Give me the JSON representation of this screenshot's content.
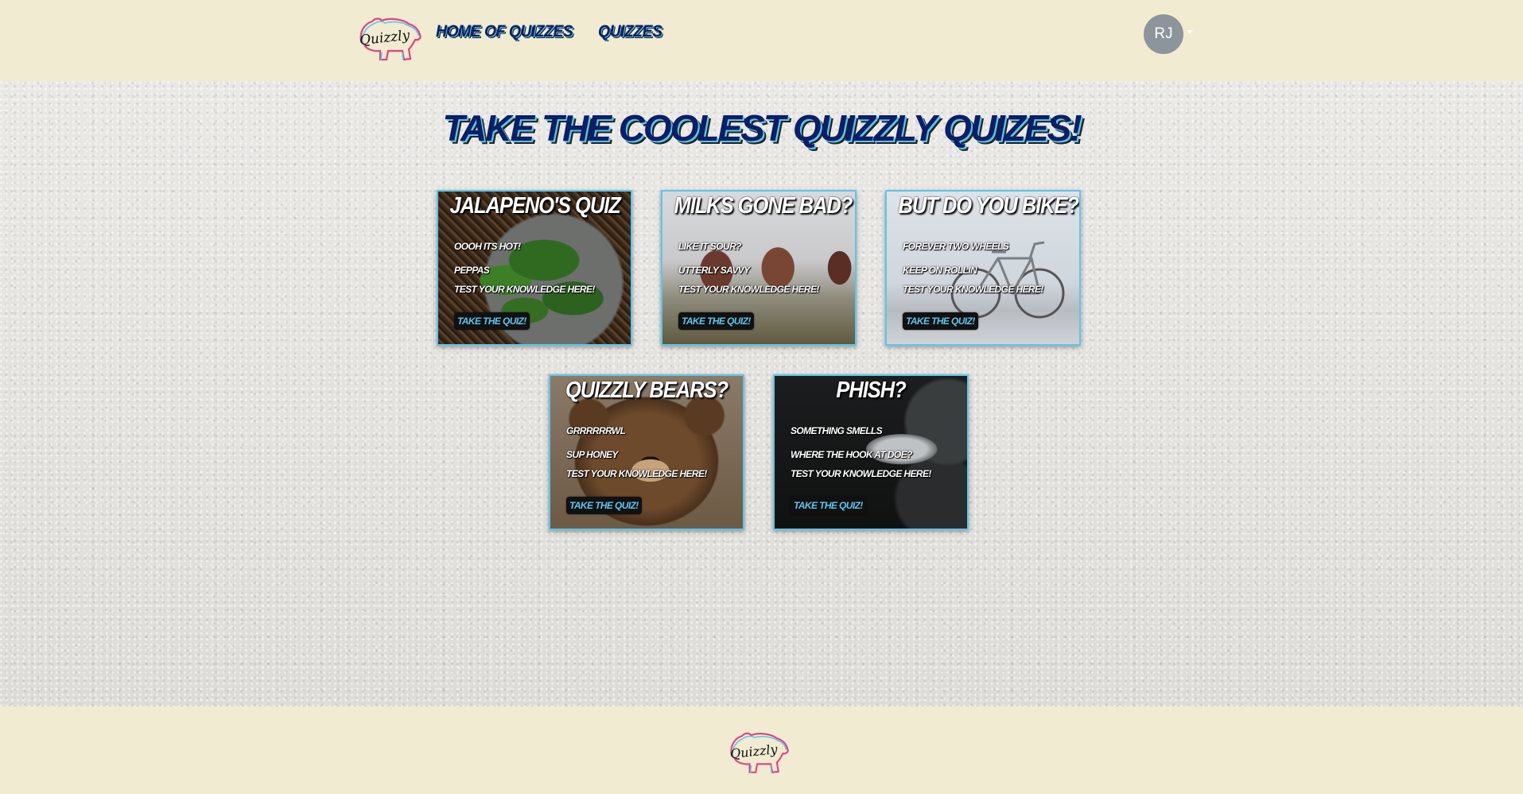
{
  "header": {
    "logo_text": "Quizzly",
    "nav": [
      {
        "label": "HOME OF QUIZZES"
      },
      {
        "label": "QUIZZES"
      }
    ],
    "avatar_initials": "RJ"
  },
  "main": {
    "title": "TAKE THE COOLEST QUIZZLY QUIZES!",
    "cards": [
      {
        "title": "JALAPENO'S QUIZ",
        "lines": [
          "OOOH ITS HOT!",
          "PEPPAS",
          "TEST YOUR KNOWLEDGE HERE!"
        ],
        "button": "TAKE THE QUIZ!"
      },
      {
        "title": "MILKS GONE BAD?",
        "lines": [
          "LIKE IT SOUR?",
          "UTTERLY SAVVY",
          "TEST YOUR KNOWLEDGE HERE!"
        ],
        "button": "TAKE THE QUIZ!"
      },
      {
        "title": "BUT DO YOU BIKE?",
        "lines": [
          "FOREVER TWO WHEELS",
          "KEEP ON ROLLIN",
          "TEST YOUR KNOWLEDGE HERE!"
        ],
        "button": "TAKE THE QUIZ!"
      },
      {
        "title": "QUIZZLY BEARS?",
        "lines": [
          "GRRRRRRWL",
          "SUP HONEY",
          "TEST YOUR KNOWLEDGE HERE!"
        ],
        "button": "TAKE THE QUIZ!"
      },
      {
        "title": "PHISH?",
        "lines": [
          "SOMETHING SMELLS",
          "WHERE THE HOOK AT DOE?",
          "TEST YOUR KNOWLEDGE HERE!"
        ],
        "button": "TAKE THE QUIZ!"
      }
    ]
  },
  "footer": {
    "logo_text": "Quizzly"
  },
  "colors": {
    "background": "#f1ebd1",
    "brand_navy": "#0b1e66",
    "accent_cyan": "#5cc6ee",
    "avatar_gray": "#8c959c"
  }
}
